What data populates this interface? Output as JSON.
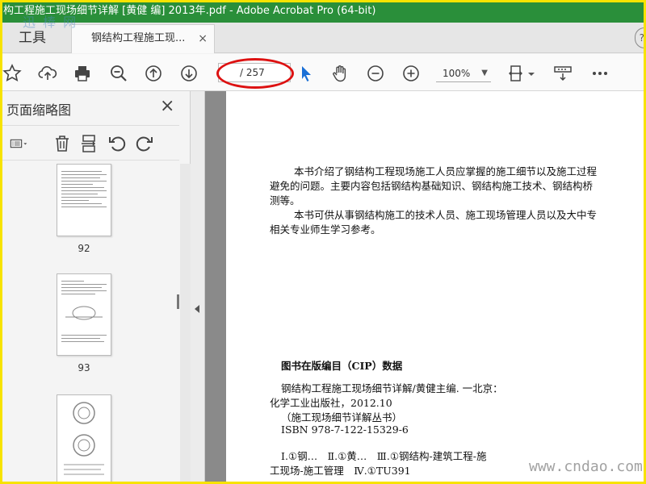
{
  "window": {
    "title": "构工程施工现场细节详解 [黄健 编] 2013年.pdf - Adobe Acrobat Pro (64-bit)"
  },
  "tabs": {
    "tools_label": "工具",
    "document_label": "钢结构工程施工现...",
    "close_symbol": "×",
    "help_symbol": "?"
  },
  "watermarks": {
    "top": "迅 棒 网",
    "bottom": "www.cndao.com"
  },
  "toolbar": {
    "page_current": "",
    "page_total": "/ 257",
    "zoom": "100%"
  },
  "sidepanel": {
    "title": "页面缩略图",
    "close_symbol": "×",
    "thumbnails": [
      {
        "label": "92"
      },
      {
        "label": "93"
      },
      {
        "label": ""
      }
    ]
  },
  "document": {
    "intro_lines": [
      "本书介绍了钢结构工程现场施工人员应掌握的施工细节以及施工过程",
      "避免的问题。主要内容包括钢结构基础知识、钢结构施工技术、钢结构桥",
      "测等。",
      "本书可供从事钢结构施工的技术人员、施工现场管理人员以及大中专",
      "相关专业师生学习参考。"
    ],
    "cip_title": "图书在版编目（CIP）数据",
    "cip_lines": [
      "钢结构工程施工现场细节详解/黄健主编. 一北京：",
      "化学工业出版社，2012.10",
      "（施工现场细节详解丛书）",
      "ISBN 978-7-122-15329-6",
      "Ⅰ.①钢…　Ⅱ.①黄…　Ⅲ.①钢结构-建筑工程-施",
      "工现场-施工管理　Ⅳ.①TU391"
    ]
  },
  "colors": {
    "titlebar": "#2a8f3a",
    "frame": "#f7e300",
    "highlight": "#d11111",
    "cursor": "#1a6fd6"
  }
}
